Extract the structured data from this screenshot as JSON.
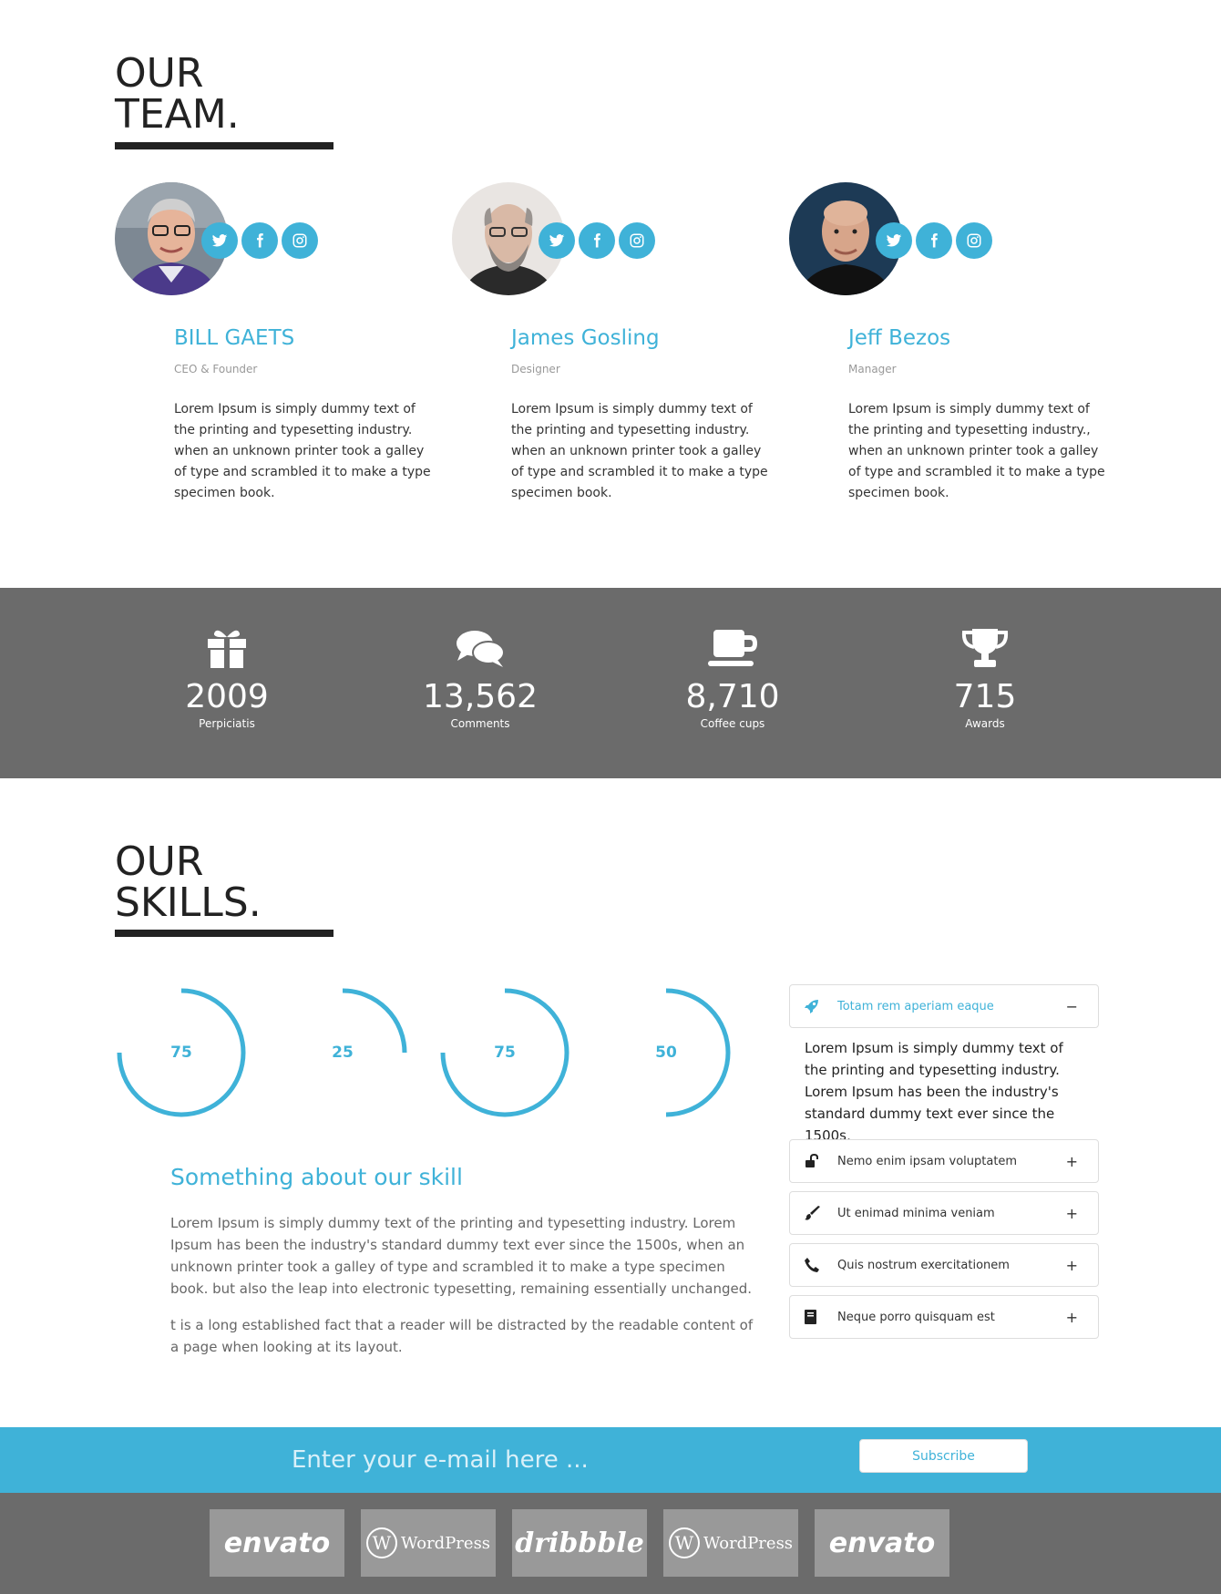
{
  "team": {
    "title_line1": "OUR",
    "title_line2": "TEAM.",
    "members": [
      {
        "name": "BILL GAETS",
        "role": "CEO & Founder",
        "bio": "Lorem Ipsum is simply dummy text of the printing and typesetting industry. when an unknown printer took a galley of type and scrambled it to make a type specimen book."
      },
      {
        "name": "James Gosling",
        "role": "Designer",
        "bio": "Lorem Ipsum is simply dummy text of the printing and typesetting industry. when an unknown printer took a galley of type and scrambled it to make a type specimen book."
      },
      {
        "name": "Jeff Bezos",
        "role": "Manager",
        "bio": "Lorem Ipsum is simply dummy text of the printing and typesetting industry., when an unknown printer took a galley of type and scrambled it to make a type specimen book."
      }
    ],
    "social_icons": [
      "twitter-icon",
      "facebook-icon",
      "instagram-icon"
    ]
  },
  "stats": [
    {
      "icon": "gift-icon",
      "value": "2009",
      "label": "Perpiciatis"
    },
    {
      "icon": "comments-icon",
      "value": "13,562",
      "label": "Comments"
    },
    {
      "icon": "coffee-cup-icon",
      "value": "8,710",
      "label": "Coffee cups"
    },
    {
      "icon": "trophy-icon",
      "value": "715",
      "label": "Awards"
    }
  ],
  "skills": {
    "title_line1": "OUR",
    "title_line2": "SKILLS.",
    "gauges": [
      {
        "value": "75",
        "percent": 75
      },
      {
        "value": "25",
        "percent": 25
      },
      {
        "value": "75",
        "percent": 75
      },
      {
        "value": "50",
        "percent": 50
      }
    ],
    "heading": "Something about our skill",
    "paragraph1": "Lorem Ipsum is simply dummy text of the printing and typesetting industry. Lorem Ipsum has been the industry's standard dummy text ever since the 1500s, when an unknown printer took a galley of type and scrambled it to make a type specimen book. but also the leap into electronic typesetting, remaining essentially unchanged.",
    "paragraph2": "t is a long established fact that a reader will be distracted by the readable content of a page when looking at its layout."
  },
  "accordion": {
    "items": [
      {
        "icon": "rocket-icon",
        "label": "Totam rem aperiam eaque",
        "sign": "−",
        "expanded": true
      },
      {
        "icon": "unlock-icon",
        "label": "Nemo enim ipsam voluptatem",
        "sign": "+"
      },
      {
        "icon": "paint-brush-icon",
        "label": "Ut enimad minima veniam",
        "sign": "+"
      },
      {
        "icon": "phone-icon",
        "label": "Quis nostrum exercitationem",
        "sign": "+"
      },
      {
        "icon": "book-icon",
        "label": "Neque porro quisquam est",
        "sign": "+"
      }
    ],
    "expanded_text": "Lorem Ipsum is simply dummy text of the printing and typesetting industry. Lorem Ipsum has been the industry's standard dummy text ever since the 1500s,"
  },
  "subscribe": {
    "placeholder": "Enter your e-mail here ...",
    "button": "Subscribe"
  },
  "footer": {
    "logos": [
      "envato",
      "WordPress",
      "dribbble",
      "WordPress",
      "envato"
    ]
  },
  "colors": {
    "accent": "#3fb2d8",
    "stats_bg": "#6b6b6b",
    "logo_bg": "#999999"
  }
}
